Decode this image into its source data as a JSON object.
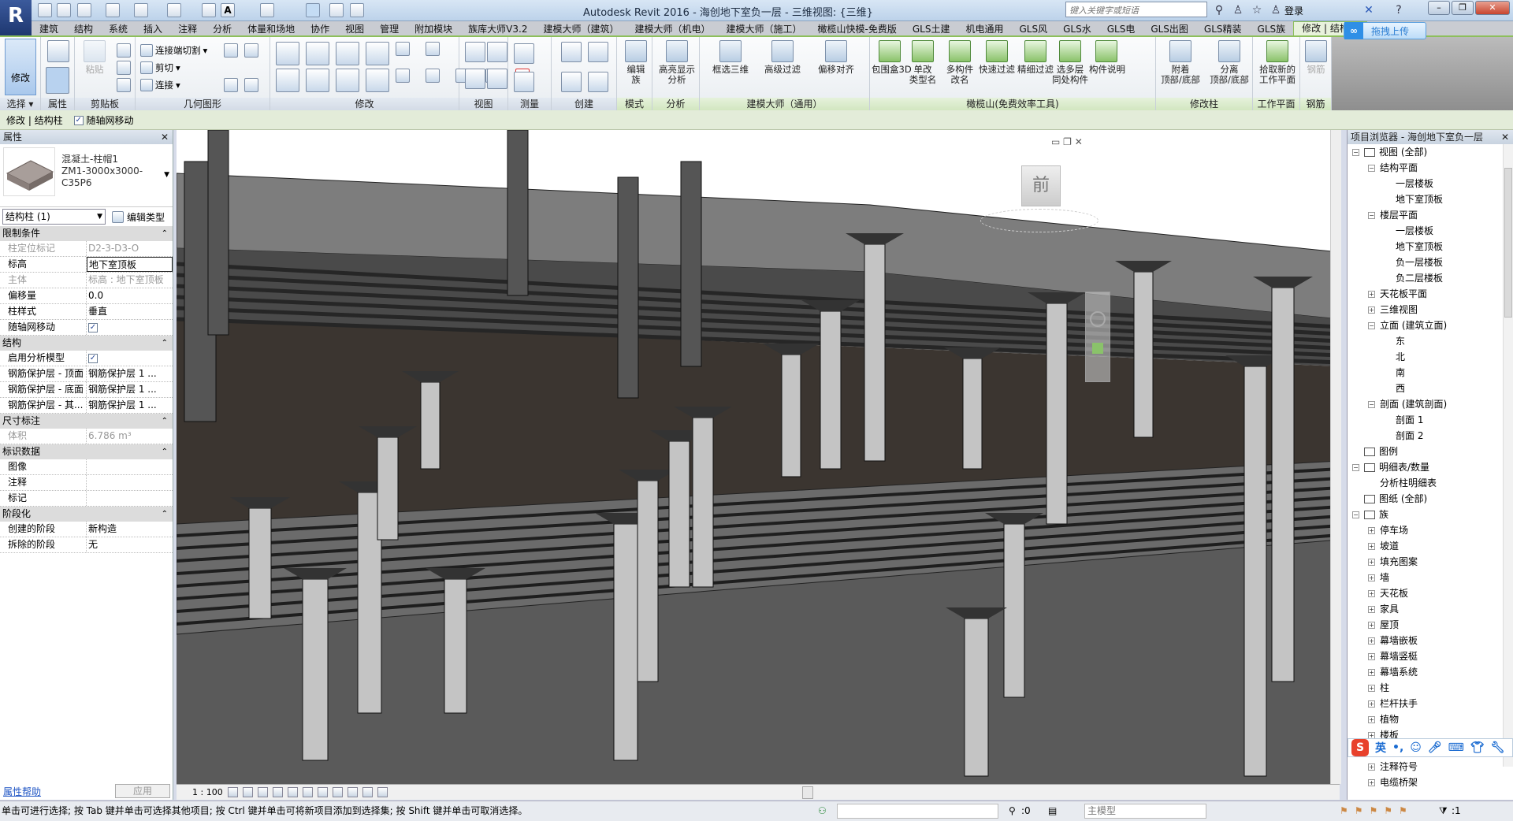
{
  "app": {
    "title": "Autodesk Revit 2016 -      海创地下室负一层 - 三维视图: {三维}",
    "search_placeholder": "键入关键字或短语",
    "login": "登录",
    "baidu_upload": "拖拽上传",
    "colors": {
      "accent_green": "#8dbf5c",
      "title_blue": "#c8dcf0",
      "floor": "#3b3530",
      "concrete": "#bdbdbd"
    }
  },
  "tabs": [
    "建筑",
    "结构",
    "系统",
    "插入",
    "注释",
    "分析",
    "体量和场地",
    "协作",
    "视图",
    "管理",
    "附加模块",
    "族库大师V3.2",
    "建模大师（建筑）",
    "建模大师（机电）",
    "建模大师（施工）",
    "橄榄山快模-免费版",
    "GLS土建",
    "机电通用",
    "GLS风",
    "GLS水",
    "GLS电",
    "GLS出图",
    "GLS精装",
    "GLS族",
    "修改 | 结构柱"
  ],
  "ribbon": {
    "panels": [
      "选择 ▾",
      "属性",
      "剪贴板",
      "几何图形",
      "修改",
      "视图",
      "测量",
      "创建",
      "模式",
      "分析",
      "建模大师（通用）",
      "橄榄山(免费效率工具)",
      "修改柱",
      "工作平面",
      "钢筋"
    ],
    "modify": "修改",
    "paste": "粘贴",
    "join_cut": "连接端切割",
    "cut": "剪切",
    "join": "连接",
    "big_buttons": [
      {
        "label": "编辑\n族"
      },
      {
        "label": "高亮显示\n分析"
      },
      {
        "label": "框选三维"
      },
      {
        "label": "高级过滤"
      },
      {
        "label": "偏移对齐"
      },
      {
        "label": "包围盒3D"
      },
      {
        "label": "单改\n类型名"
      },
      {
        "label": "多构件\n改名"
      },
      {
        "label": "快速过滤"
      },
      {
        "label": "精细过滤"
      },
      {
        "label": "选多层\n同处构件"
      },
      {
        "label": "构件说明"
      },
      {
        "label": "附着\n顶部/底部"
      },
      {
        "label": "分离\n顶部/底部"
      },
      {
        "label": "拾取新的\n工作平面"
      },
      {
        "label": "钢筋"
      }
    ]
  },
  "context_bar": {
    "label": "修改 | 结构柱",
    "move_with_grid": "随轴网移动",
    "move_with_grid_checked": true
  },
  "properties": {
    "title": "属性",
    "type_name": "混凝土-柱帽1",
    "type_detail": "ZM1-3000x3000-",
    "type_detail2": "C35P6",
    "instance_selector": "结构柱 (1)",
    "edit_type": "编辑类型",
    "groups": [
      {
        "name": "限制条件",
        "rows": [
          {
            "k": "柱定位标记",
            "v": "D2-3-D3-O",
            "disabled": true
          },
          {
            "k": "标高",
            "v": "地下室顶板",
            "boxed": true
          },
          {
            "k": "主体",
            "v": "标高 : 地下室顶板",
            "disabled": true
          },
          {
            "k": "偏移量",
            "v": "0.0"
          },
          {
            "k": "柱样式",
            "v": "垂直"
          },
          {
            "k": "随轴网移动",
            "v": "",
            "check": true
          }
        ]
      },
      {
        "name": "结构",
        "rows": [
          {
            "k": "启用分析模型",
            "v": "",
            "check": true
          },
          {
            "k": "钢筋保护层 - 顶面",
            "v": "钢筋保护层 1 ..."
          },
          {
            "k": "钢筋保护层 - 底面",
            "v": "钢筋保护层 1 ..."
          },
          {
            "k": "钢筋保护层 - 其...",
            "v": "钢筋保护层 1 ..."
          }
        ]
      },
      {
        "name": "尺寸标注",
        "rows": [
          {
            "k": "体积",
            "v": "6.786 m³",
            "disabled": true
          }
        ]
      },
      {
        "name": "标识数据",
        "rows": [
          {
            "k": "图像",
            "v": ""
          },
          {
            "k": "注释",
            "v": ""
          },
          {
            "k": "标记",
            "v": ""
          }
        ]
      },
      {
        "name": "阶段化",
        "rows": [
          {
            "k": "创建的阶段",
            "v": "新构造"
          },
          {
            "k": "拆除的阶段",
            "v": "无"
          }
        ]
      }
    ],
    "help": "属性帮助",
    "apply": "应用"
  },
  "view": {
    "viewcube_face": "前",
    "scale": "1 : 100"
  },
  "browser": {
    "title": "项目浏览器 - 海创地下室负一层",
    "items": [
      {
        "label": "视图 (全部)",
        "level": 0,
        "tog": "-",
        "icon": true
      },
      {
        "label": "结构平面",
        "level": 1,
        "tog": "-"
      },
      {
        "label": "一层楼板",
        "level": 2
      },
      {
        "label": "地下室顶板",
        "level": 2
      },
      {
        "label": "楼层平面",
        "level": 1,
        "tog": "-"
      },
      {
        "label": "一层楼板",
        "level": 2
      },
      {
        "label": "地下室顶板",
        "level": 2
      },
      {
        "label": "负一层楼板",
        "level": 2
      },
      {
        "label": "负二层楼板",
        "level": 2
      },
      {
        "label": "天花板平面",
        "level": 1,
        "tog": "+"
      },
      {
        "label": "三维视图",
        "level": 1,
        "tog": "+"
      },
      {
        "label": "立面 (建筑立面)",
        "level": 1,
        "tog": "-"
      },
      {
        "label": "东",
        "level": 2
      },
      {
        "label": "北",
        "level": 2
      },
      {
        "label": "南",
        "level": 2
      },
      {
        "label": "西",
        "level": 2
      },
      {
        "label": "剖面 (建筑剖面)",
        "level": 1,
        "tog": "-"
      },
      {
        "label": "剖面 1",
        "level": 2
      },
      {
        "label": "剖面 2",
        "level": 2
      },
      {
        "label": "图例",
        "level": 0,
        "icon": true
      },
      {
        "label": "明细表/数量",
        "level": 0,
        "tog": "-",
        "icon": true
      },
      {
        "label": "分析柱明细表",
        "level": 1
      },
      {
        "label": "图纸 (全部)",
        "level": 0,
        "icon": true
      },
      {
        "label": "族",
        "level": 0,
        "tog": "-",
        "icon": true
      },
      {
        "label": "停车场",
        "level": 1,
        "tog": "+"
      },
      {
        "label": "坡道",
        "level": 1,
        "tog": "+"
      },
      {
        "label": "填充图案",
        "level": 1,
        "tog": "+"
      },
      {
        "label": "墙",
        "level": 1,
        "tog": "+"
      },
      {
        "label": "天花板",
        "level": 1,
        "tog": "+"
      },
      {
        "label": "家具",
        "level": 1,
        "tog": "+"
      },
      {
        "label": "屋顶",
        "level": 1,
        "tog": "+"
      },
      {
        "label": "幕墙嵌板",
        "level": 1,
        "tog": "+"
      },
      {
        "label": "幕墙竖梃",
        "level": 1,
        "tog": "+"
      },
      {
        "label": "幕墙系统",
        "level": 1,
        "tog": "+"
      },
      {
        "label": "柱",
        "level": 1,
        "tog": "+"
      },
      {
        "label": "栏杆扶手",
        "level": 1,
        "tog": "+"
      },
      {
        "label": "植物",
        "level": 1,
        "tog": "+"
      },
      {
        "label": "楼板",
        "level": 1,
        "tog": "+"
      },
      {
        "label": "",
        "level": 1
      },
      {
        "label": "注释符号",
        "level": 1,
        "tog": "+"
      },
      {
        "label": "电缆桥架",
        "level": 1,
        "tog": "+"
      }
    ]
  },
  "ime": {
    "lang": "英"
  },
  "status": {
    "message": "单击可进行选择; 按 Tab 键并单击可选择其他项目; 按 Ctrl 键并单击可将新项目添加到选择集; 按 Shift 键并单击可取消选择。",
    "count": ":0",
    "model": "主模型",
    "filter_count": ":1"
  }
}
